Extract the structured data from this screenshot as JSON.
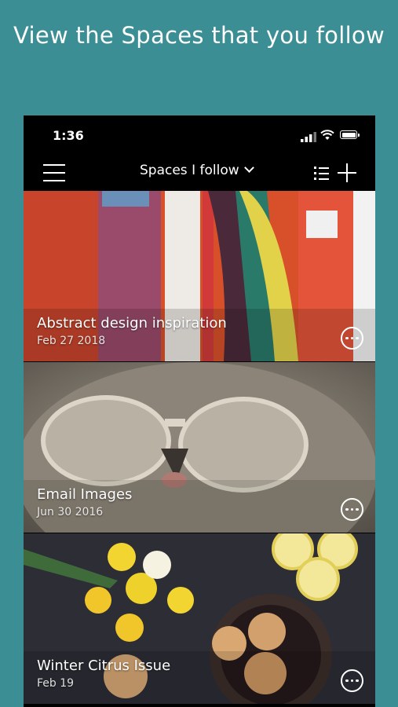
{
  "headline": "View the Spaces that you follow",
  "status_bar": {
    "time": "1:36"
  },
  "nav": {
    "title": "Spaces I follow"
  },
  "spaces": [
    {
      "title": "Abstract design inspiration",
      "date": "Feb 27 2018"
    },
    {
      "title": "Email Images",
      "date": "Jun 30 2016"
    },
    {
      "title": "Winter Citrus Issue",
      "date": "Feb 19"
    }
  ],
  "icons": {
    "menu": "hamburger-menu-icon",
    "dropdown": "chevron-down-icon",
    "list": "list-view-icon",
    "add": "plus-icon",
    "more": "more-options-icon"
  },
  "colors": {
    "background": "#3b8e93",
    "bar": "#000000"
  }
}
